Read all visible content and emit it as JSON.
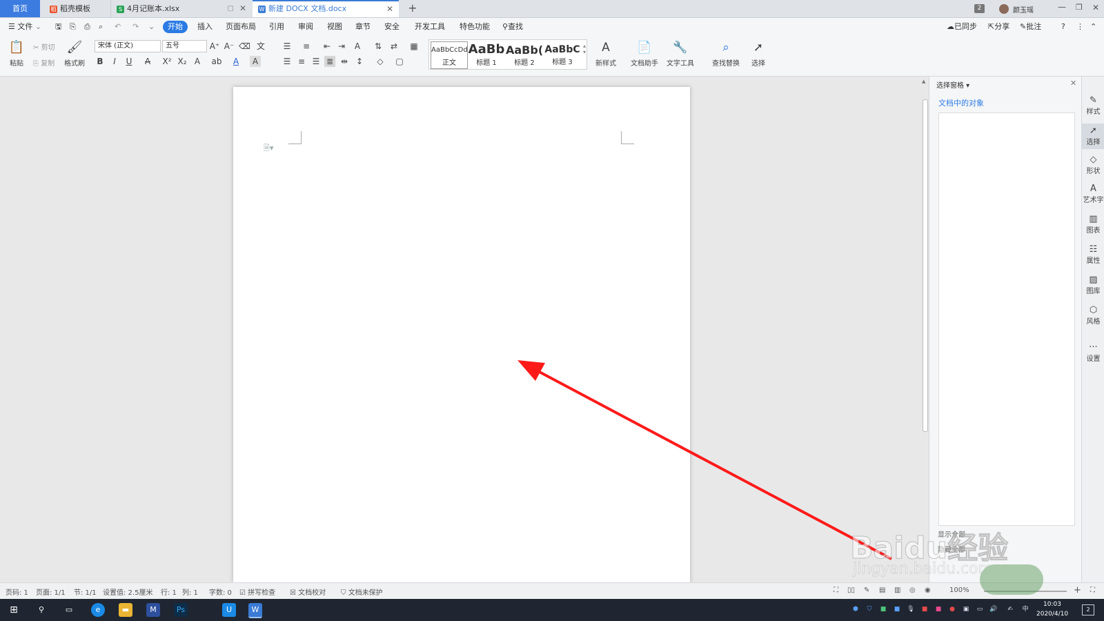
{
  "tabs": [
    {
      "label": "首页",
      "active_home": true
    },
    {
      "label": "稻壳模板",
      "icon_color": "#e8542e"
    },
    {
      "label": "4月记账本.xlsx",
      "icon_color": "#2aa457"
    },
    {
      "label": "新建 DOCX 文档.docx",
      "icon_color": "#3a7bd5",
      "active": true
    }
  ],
  "window": {
    "badge": "2",
    "user": "颜玉瑶"
  },
  "menu": {
    "file": "文件",
    "items": [
      "开始",
      "插入",
      "页面布局",
      "引用",
      "审阅",
      "视图",
      "章节",
      "安全",
      "开发工具",
      "特色功能"
    ],
    "active_index": 0,
    "search": "查找",
    "right": [
      "已同步",
      "分享",
      "批注"
    ]
  },
  "toolbar": {
    "paste": "粘贴",
    "cut": "剪切",
    "copy": "复制",
    "format_painter": "格式刷",
    "font": "宋体 (正文)",
    "size": "五号",
    "styles": [
      {
        "preview": "AaBbCcDd",
        "label": "正文"
      },
      {
        "preview": "AaBb",
        "label": "标题 1"
      },
      {
        "preview": "AaBb(",
        "label": "标题 2"
      },
      {
        "preview": "AaBbC",
        "label": "标题 3"
      }
    ],
    "new_style": "新样式",
    "doc_helper": "文档助手",
    "text_tools": "文字工具",
    "find_replace": "查找替换",
    "select": "选择"
  },
  "panel": {
    "title": "选择窗格",
    "subtitle": "文档中的对象",
    "show_all": "显示全部",
    "hide_all": "隐藏全部"
  },
  "sidebar": [
    "样式",
    "选择",
    "形状",
    "艺术字",
    "图表",
    "属性",
    "图库",
    "风格",
    "设置"
  ],
  "status": {
    "page_no": "页码: 1",
    "pages": "页面: 1/1",
    "section": "节: 1/1",
    "setting": "设置值: 2.5厘米",
    "row": "行: 1",
    "col": "列: 1",
    "words": "字数: 0",
    "spell": "拼写检查",
    "proof": "文档校对",
    "protect": "文档未保护",
    "zoom": "100%"
  },
  "taskbar": {
    "time": "10:03",
    "date": "2020/4/10",
    "ime": "中",
    "notif": "2"
  },
  "watermark": {
    "text": "Baidu经验",
    "url": "jingyan.baidu.com"
  },
  "colors": {
    "accent": "#2b7be4",
    "arrow": "#ff1a1a",
    "taskbar": "#1f2631"
  }
}
